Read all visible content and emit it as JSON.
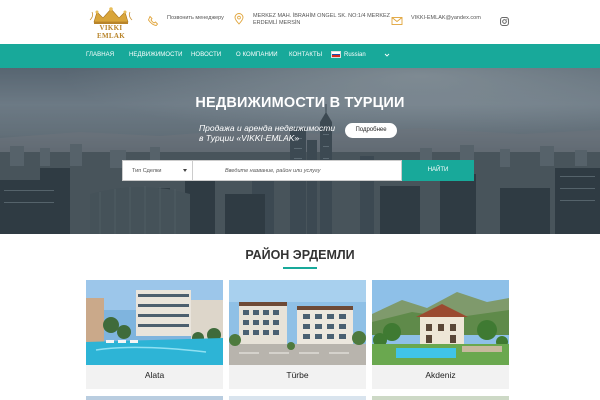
{
  "header": {
    "logo_text": "VIKKI EMLAK",
    "phone_label": "Позвонить менеджеру",
    "address": "MERKEZ MAH. İBRAHİM ONGEL SK. NO:1/4 MERKEZ ERDEMLİ MERSİN",
    "email": "VIKKI-EMLAK@yandex.com",
    "icons": [
      "phone-icon",
      "map-pin-icon",
      "mail-icon",
      "instagram-icon"
    ]
  },
  "nav": {
    "items": [
      "ГЛАВНАЯ",
      "НЕДВИЖИМОСТИ",
      "НОВОСТИ",
      "О КОМПАНИИ",
      "КОНТАКТЫ"
    ],
    "language": "Russian"
  },
  "hero": {
    "title": "НЕДВИЖИМОСТИ В ТУРЦИИ",
    "subtitle_line1": "Продажа и аренда недвижимости",
    "subtitle_line2": "в Турции «VIKKI-EMLAK»",
    "more_button": "Подробнее"
  },
  "search": {
    "deal_type": "Тип Сделки",
    "placeholder": "Введите название, район или услугу",
    "button": "НАЙТИ"
  },
  "section": {
    "title": "РАЙОН ЭРДЕМЛИ",
    "cards": [
      {
        "label": "Alata"
      },
      {
        "label": "Türbe"
      },
      {
        "label": "Akdeniz"
      }
    ]
  },
  "colors": {
    "accent": "#18a99a",
    "logo_gold": "#b8842a"
  }
}
